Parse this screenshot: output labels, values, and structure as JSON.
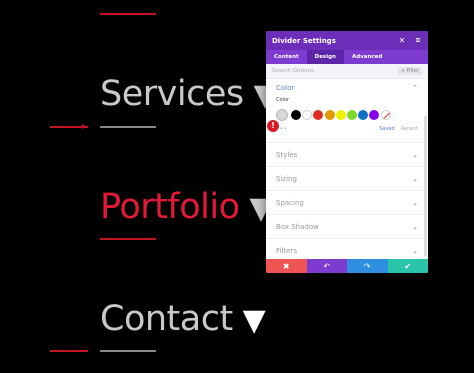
{
  "menu": {
    "items": [
      {
        "label": "Services",
        "arrow": "▼"
      },
      {
        "label": "Portfolio",
        "arrow": "▼"
      },
      {
        "label": "Contact",
        "arrow": "▼"
      }
    ]
  },
  "panel": {
    "title": "Divider Settings",
    "tabs": [
      "Content",
      "Design",
      "Advanced"
    ],
    "search_placeholder": "Search Options",
    "filter_label": "+ Filter",
    "color_section": {
      "heading": "Color",
      "sub_label": "Color",
      "swatches": [
        "#000000",
        "#ffffff",
        "#e02b20",
        "#e09900",
        "#edf000",
        "#7cda24",
        "#0c71c3",
        "#8300e9"
      ],
      "dots": "•••",
      "saved_label": "Saved",
      "recent_label": "Recent",
      "badge": "!"
    },
    "sections": [
      "Styles",
      "Sizing",
      "Spacing",
      "Box Shadow",
      "Filters"
    ],
    "footer": {
      "cancel_icon": "✖",
      "undo_icon": "↶",
      "redo_icon": "↷",
      "save_icon": "✔",
      "colors": [
        "#ef5555",
        "#7e3bd0",
        "#2f8ee0",
        "#29c4a9"
      ]
    }
  },
  "colors": {
    "accent_red": "#e31a37",
    "menu_grey": "#c9c9c9"
  }
}
